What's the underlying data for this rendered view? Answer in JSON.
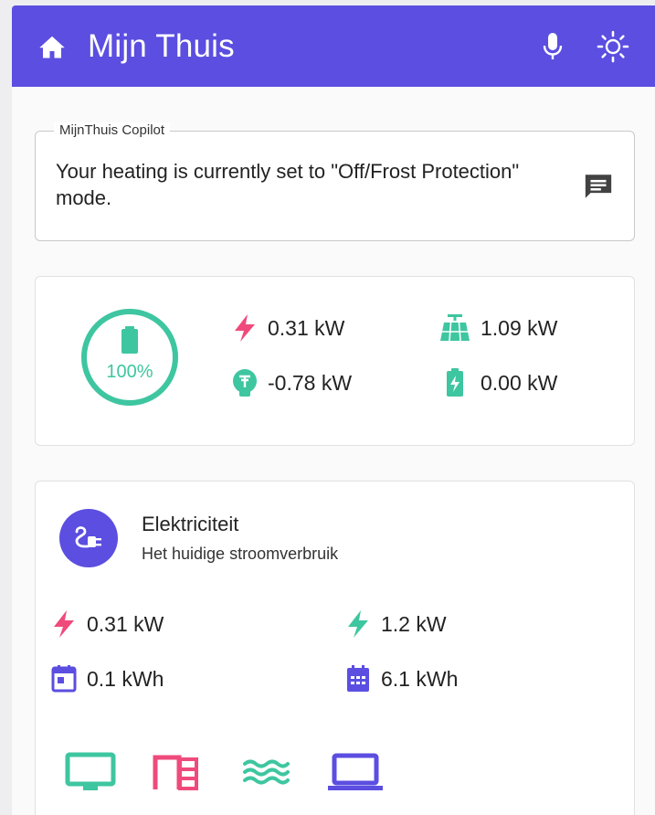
{
  "header": {
    "title": "Mijn Thuis",
    "icons": [
      "home-icon",
      "microphone-icon",
      "brightness-icon"
    ]
  },
  "copilot": {
    "legend": "MijnThuis Copilot",
    "message": "Your heating is currently set to \"Off/Frost Protection\" mode.",
    "icon": "chat-icon"
  },
  "energy": {
    "battery_level": 1.0,
    "battery_label": "100%",
    "consumption": "0.31 kW",
    "solar": "1.09 kW",
    "grid": "-0.78 kW",
    "battery_power": "0.00 kW"
  },
  "electricity": {
    "title": "Elektriciteit",
    "subtitle": "Het huidige stroomverbruik",
    "current_usage": "0.31 kW",
    "current_peak": "1.2 kW",
    "day_total": "0.1 kWh",
    "month_total": "6.1 kWh",
    "devices": [
      "monitor-icon",
      "dishwasher-icon",
      "water-heater-icon",
      "laptop-icon"
    ]
  },
  "colors": {
    "primary": "#5b4ee0",
    "pink": "#ef4a7b",
    "teal": "#3ec6a0"
  }
}
